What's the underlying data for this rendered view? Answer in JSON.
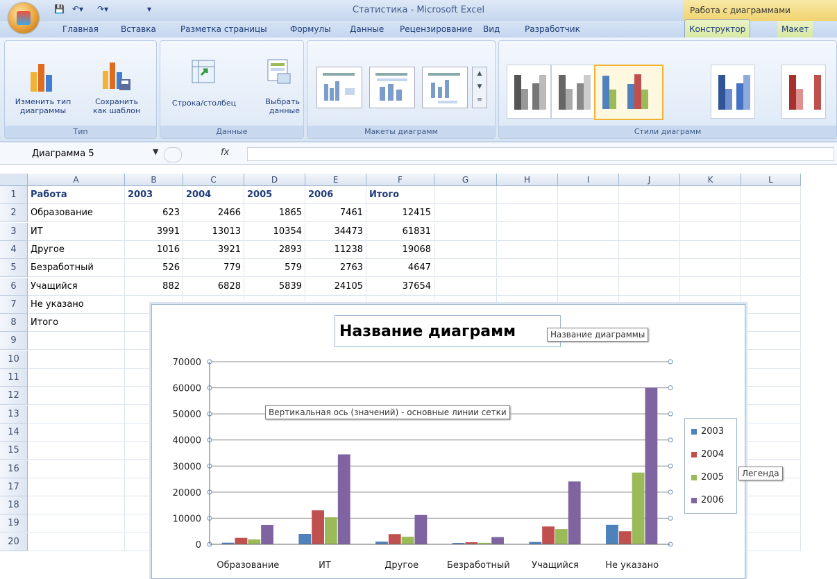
{
  "window": {
    "title": "Статистика - Microsoft Excel",
    "context_title": "Работа с диаграммами"
  },
  "tabs": [
    "Главная",
    "Вставка",
    "Разметка страницы",
    "Формулы",
    "Данные",
    "Рецензирование",
    "Вид",
    "Разработчик",
    "Конструктор",
    "Макет"
  ],
  "ribbon": {
    "type_group": {
      "change_type_line1": "Изменить тип",
      "change_type_line2": "диаграммы",
      "save_template_line1": "Сохранить",
      "save_template_line2": "как шаблон",
      "label": "Тип"
    },
    "data_group": {
      "rowcol": "Строка/столбец",
      "select_line1": "Выбрать",
      "select_line2": "данные",
      "label": "Данные"
    },
    "layouts_group": {
      "label": "Макеты диаграмм"
    },
    "styles_group": {
      "label": "Стили диаграмм"
    }
  },
  "formula_bar": {
    "name_box": "Диаграмма 5",
    "fx": "fx"
  },
  "columns": [
    "A",
    "B",
    "C",
    "D",
    "E",
    "F",
    "G",
    "H",
    "I",
    "J",
    "K",
    "L"
  ],
  "rows": [
    "1",
    "2",
    "3",
    "4",
    "5",
    "6",
    "7",
    "8",
    "9",
    "10",
    "11",
    "12",
    "13",
    "14",
    "15",
    "16",
    "17",
    "18",
    "19",
    "20"
  ],
  "sheet": {
    "header": [
      "Работа",
      "2003",
      "2004",
      "2005",
      "2006",
      "Итого"
    ],
    "data": [
      [
        "Образование",
        "623",
        "2466",
        "1865",
        "7461",
        "12415"
      ],
      [
        "ИТ",
        "3991",
        "13013",
        "10354",
        "34473",
        "61831"
      ],
      [
        "Другое",
        "1016",
        "3921",
        "2893",
        "11238",
        "19068"
      ],
      [
        "Безработный",
        "526",
        "779",
        "579",
        "2763",
        "4647"
      ],
      [
        "Учащийся",
        "882",
        "6828",
        "5839",
        "24105",
        "37654"
      ]
    ],
    "extra_labels": [
      "Не указано",
      "Итого"
    ]
  },
  "chart": {
    "title": "Название диаграммы",
    "title_visible": "Название диаграмм",
    "tooltips": {
      "title": "Название диаграммы",
      "gridlines": "Вертикальная ось (значений)  - основные линии сетки",
      "legend": "Легенда"
    }
  },
  "chart_data": {
    "type": "bar",
    "categories": [
      "Образование",
      "ИТ",
      "Другое",
      "Безработный",
      "Учащийся",
      "Не указано"
    ],
    "series": [
      {
        "name": "2003",
        "values": [
          623,
          3991,
          1016,
          526,
          882,
          7500
        ]
      },
      {
        "name": "2004",
        "values": [
          2466,
          13013,
          3921,
          779,
          6828,
          5000
        ]
      },
      {
        "name": "2005",
        "values": [
          1865,
          10354,
          2893,
          579,
          5839,
          27500
        ]
      },
      {
        "name": "2006",
        "values": [
          7461,
          34473,
          11238,
          2763,
          24105,
          60000
        ]
      }
    ],
    "ylim": [
      0,
      70000
    ],
    "yticks": [
      "0",
      "10000",
      "20000",
      "30000",
      "40000",
      "50000",
      "60000",
      "70000"
    ],
    "colors": [
      "#4f81bd",
      "#c0504d",
      "#9bbb59",
      "#8064a2"
    ],
    "grid": true,
    "legend": "right"
  }
}
